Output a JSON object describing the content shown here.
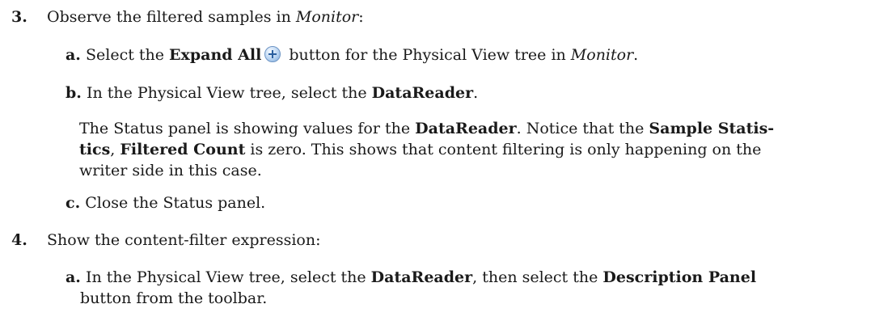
{
  "steps": [
    {
      "number": "3.",
      "text": "Observe the filtered samples in ",
      "text_em": "Monitor",
      "text_end": ":",
      "substeps": [
        {
          "letter": "a.",
          "pre": "Select the ",
          "bold1": "Expand All",
          "icon": "expand-all-icon",
          "mid": " button for the Physical View tree in ",
          "em": "Monitor",
          "end": "."
        },
        {
          "letter": "b.",
          "pre": "In the Physical View tree, select the ",
          "bold1": "DataReader",
          "end": "."
        }
      ],
      "paragraph": {
        "line1_pre": "The Status panel is showing values for the ",
        "line1_bold": "DataReader",
        "line1_mid": ". Notice that the ",
        "line1_bold2": "Sample Statis-",
        "line2_bold": "tics",
        "line2_mid": ", ",
        "line2_bold2": "Filtered Count",
        "line2_end": " is zero. This shows that content filtering is only happening on the",
        "line3": "writer side in this case."
      },
      "substep_c": {
        "letter": "c.",
        "text": "Close the Status panel."
      }
    },
    {
      "number": "4.",
      "text": "Show the content-filter expression:",
      "substeps": [
        {
          "letter": "a.",
          "pre": "In the Physical View tree, select the ",
          "bold1": "DataReader",
          "mid": ", then select the ",
          "bold2": "Description Panel",
          "line2": "button from the toolbar."
        }
      ]
    }
  ]
}
